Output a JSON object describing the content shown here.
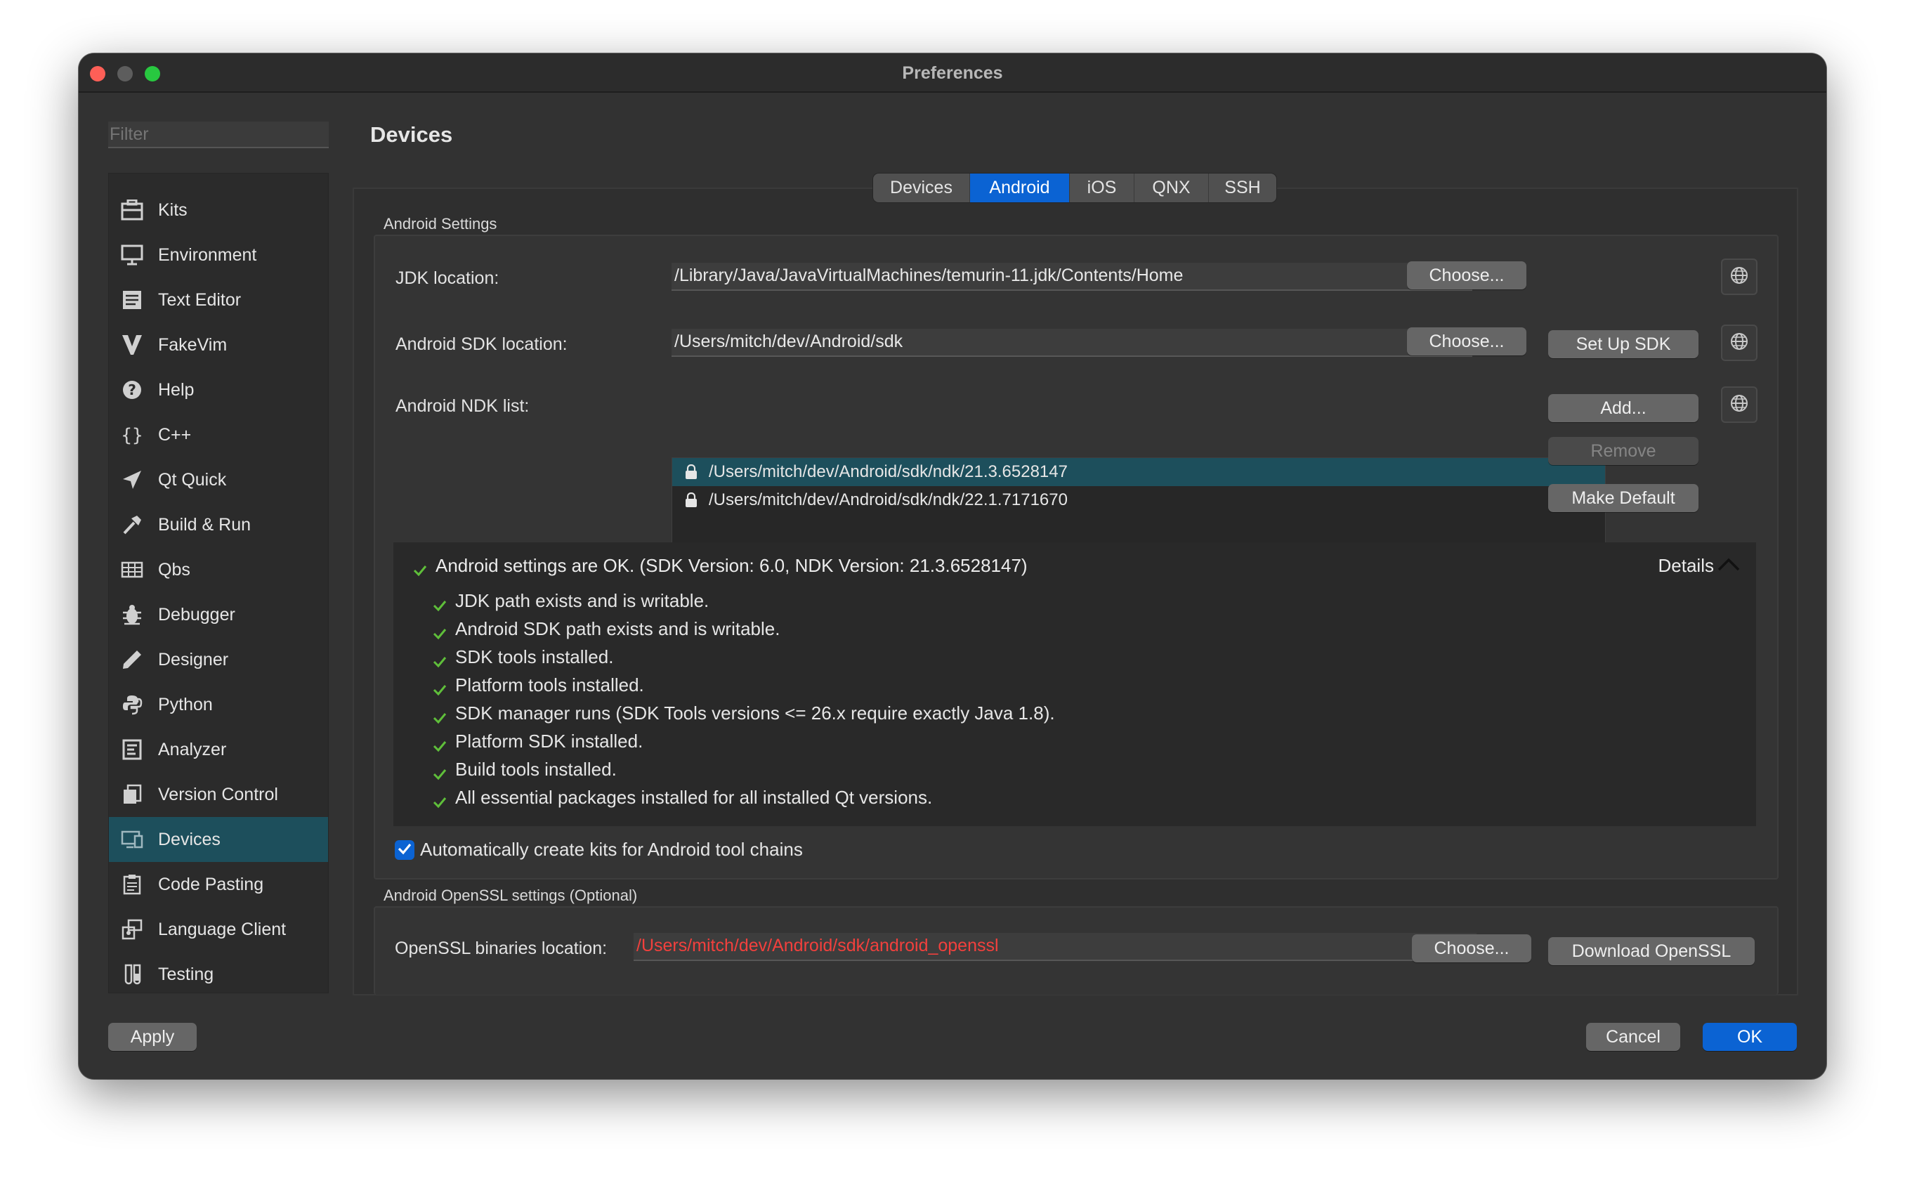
{
  "window": {
    "title": "Preferences"
  },
  "sidebar": {
    "filter_placeholder": "Filter",
    "items": [
      {
        "label": "Kits",
        "icon": "kits-icon"
      },
      {
        "label": "Environment",
        "icon": "monitor-icon"
      },
      {
        "label": "Text Editor",
        "icon": "text-editor-icon"
      },
      {
        "label": "FakeVim",
        "icon": "fakevim-icon"
      },
      {
        "label": "Help",
        "icon": "help-icon"
      },
      {
        "label": "C++",
        "icon": "braces-icon"
      },
      {
        "label": "Qt Quick",
        "icon": "qt-quick-icon"
      },
      {
        "label": "Build & Run",
        "icon": "hammer-icon"
      },
      {
        "label": "Qbs",
        "icon": "qbs-icon"
      },
      {
        "label": "Debugger",
        "icon": "bug-icon"
      },
      {
        "label": "Designer",
        "icon": "pencil-icon"
      },
      {
        "label": "Python",
        "icon": "python-icon"
      },
      {
        "label": "Analyzer",
        "icon": "analyzer-icon"
      },
      {
        "label": "Version Control",
        "icon": "version-control-icon"
      },
      {
        "label": "Devices",
        "icon": "devices-icon",
        "selected": true
      },
      {
        "label": "Code Pasting",
        "icon": "clipboard-icon"
      },
      {
        "label": "Language Client",
        "icon": "language-client-icon"
      },
      {
        "label": "Testing",
        "icon": "testing-icon"
      }
    ]
  },
  "main": {
    "title": "Devices",
    "tabs": [
      {
        "label": "Devices"
      },
      {
        "label": "Android",
        "active": true
      },
      {
        "label": "iOS"
      },
      {
        "label": "QNX"
      },
      {
        "label": "SSH"
      }
    ],
    "android": {
      "group_title": "Android Settings",
      "jdk_label": "JDK location:",
      "jdk_value": "/Library/Java/JavaVirtualMachines/temurin-11.jdk/Contents/Home",
      "sdk_label": "Android SDK location:",
      "sdk_value": "/Users/mitch/dev/Android/sdk",
      "ndk_label": "Android NDK list:",
      "ndk_items": [
        "/Users/mitch/dev/Android/sdk/ndk/21.3.6528147",
        "/Users/mitch/dev/Android/sdk/ndk/22.1.7171670"
      ],
      "choose_label": "Choose...",
      "setup_sdk_label": "Set Up SDK",
      "add_label": "Add...",
      "remove_label": "Remove",
      "make_default_label": "Make Default",
      "status_summary": "Android settings are OK. (SDK Version: 6.0, NDK Version: 21.3.6528147)",
      "details_label": "Details",
      "status_items": [
        "JDK path exists and is writable.",
        "Android SDK path exists and is writable.",
        "SDK tools installed.",
        "Platform tools installed.",
        "SDK manager runs (SDK Tools versions <= 26.x require exactly Java 1.8).",
        "Platform SDK installed.",
        "Build tools installed.",
        "All essential packages installed for all installed Qt versions."
      ],
      "auto_kits_label": "Automatically create kits for Android tool chains",
      "auto_kits_checked": true
    },
    "openssl": {
      "group_title": "Android OpenSSL settings (Optional)",
      "label": "OpenSSL binaries location:",
      "value": "/Users/mitch/dev/Android/sdk/android_openssl",
      "choose_label": "Choose...",
      "download_label": "Download OpenSSL"
    }
  },
  "footer": {
    "apply_label": "Apply",
    "cancel_label": "Cancel",
    "ok_label": "OK"
  },
  "colors": {
    "accent": "#0b63d3",
    "selection": "#1d4f5c",
    "check": "#5fbf3a",
    "error": "#f2403d"
  }
}
